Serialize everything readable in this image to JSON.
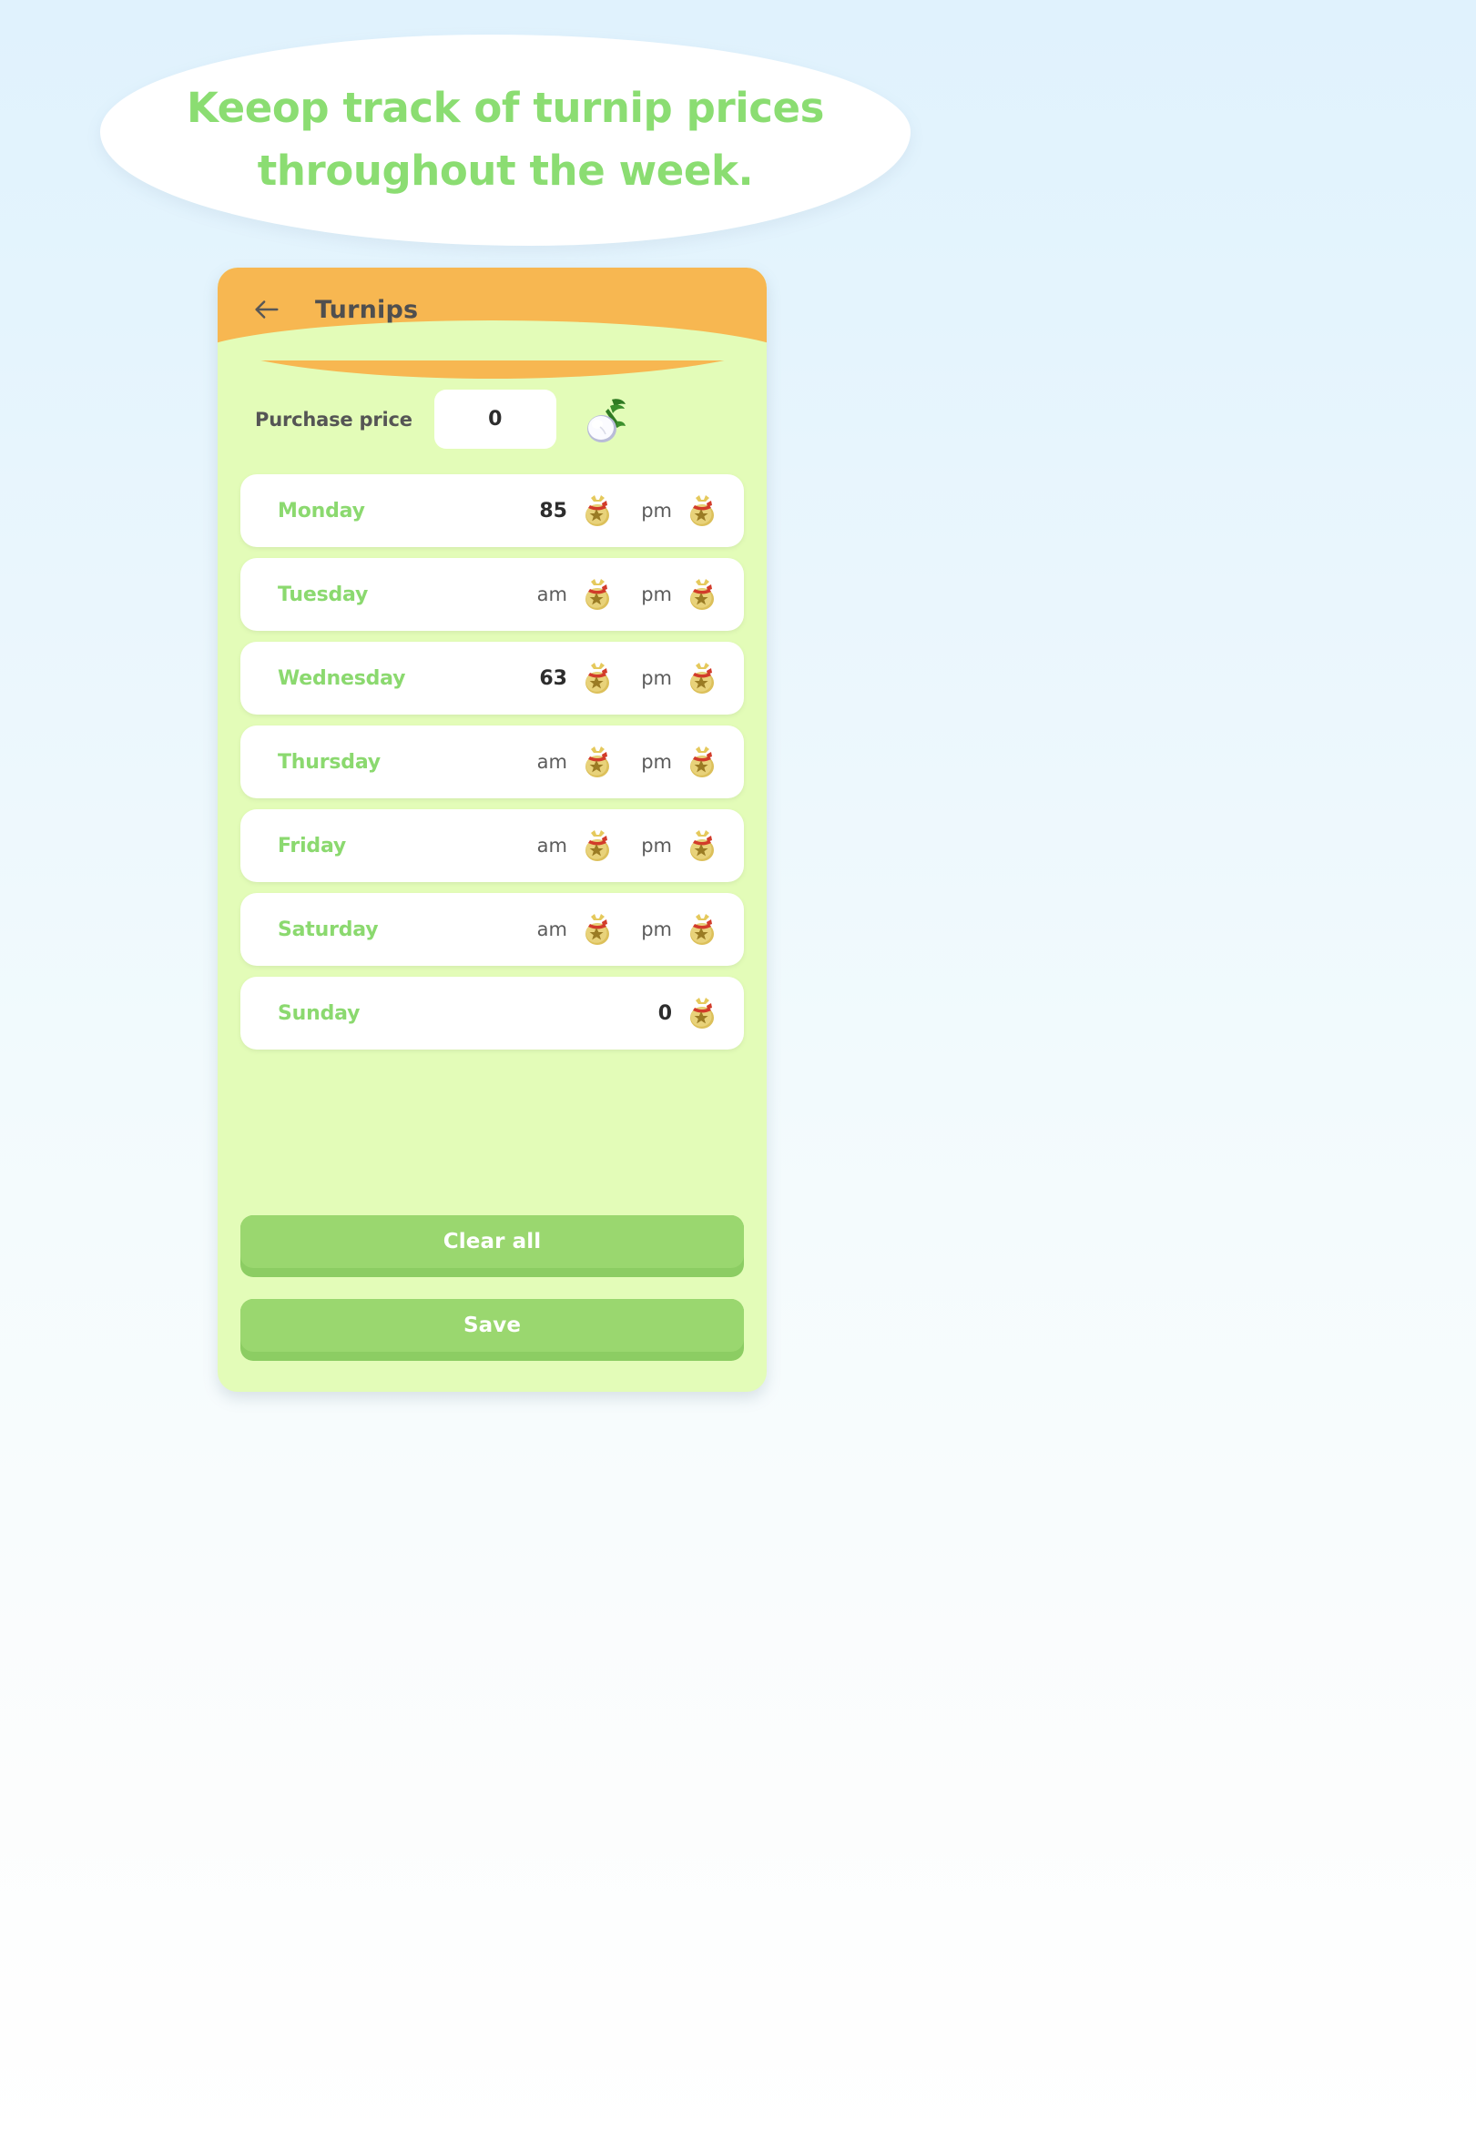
{
  "promo": {
    "line1": "Keeop track of turnip prices",
    "line2": "throughout the week.",
    "text_color": "#8bdd72"
  },
  "appbar": {
    "back_icon": "arrow-left-icon",
    "title": "Turnips",
    "background_color": "#f7b751",
    "title_color": "#4f4f4f"
  },
  "purchase": {
    "label": "Purchase price",
    "value": "0",
    "icon": "turnip-icon"
  },
  "days": [
    {
      "name": "Monday",
      "am": "85",
      "am_is_placeholder": false,
      "pm": "pm",
      "pm_is_placeholder": true,
      "has_pm": true
    },
    {
      "name": "Tuesday",
      "am": "am",
      "am_is_placeholder": true,
      "pm": "pm",
      "pm_is_placeholder": true,
      "has_pm": true
    },
    {
      "name": "Wednesday",
      "am": "63",
      "am_is_placeholder": false,
      "pm": "pm",
      "pm_is_placeholder": true,
      "has_pm": true
    },
    {
      "name": "Thursday",
      "am": "am",
      "am_is_placeholder": true,
      "pm": "pm",
      "pm_is_placeholder": true,
      "has_pm": true
    },
    {
      "name": "Friday",
      "am": "am",
      "am_is_placeholder": true,
      "pm": "pm",
      "pm_is_placeholder": true,
      "has_pm": true
    },
    {
      "name": "Saturday",
      "am": "am",
      "am_is_placeholder": true,
      "pm": "pm",
      "pm_is_placeholder": true,
      "has_pm": true
    },
    {
      "name": "Sunday",
      "am": "0",
      "am_is_placeholder": false,
      "pm": "",
      "pm_is_placeholder": false,
      "has_pm": false
    }
  ],
  "buttons": {
    "clear_all": "Clear all",
    "save": "Save"
  },
  "colors": {
    "card_background": "#e3fcb8",
    "row_background": "#ffffff",
    "day_label": "#8bd96f",
    "button_face": "#9ad76f",
    "button_edge": "#8ccd63",
    "page_background_top": "#e0f2fd",
    "page_background_bottom": "#ffffff"
  },
  "icons": {
    "bag": "money-bag-icon",
    "turnip": "turnip-icon",
    "back": "arrow-left-icon"
  }
}
